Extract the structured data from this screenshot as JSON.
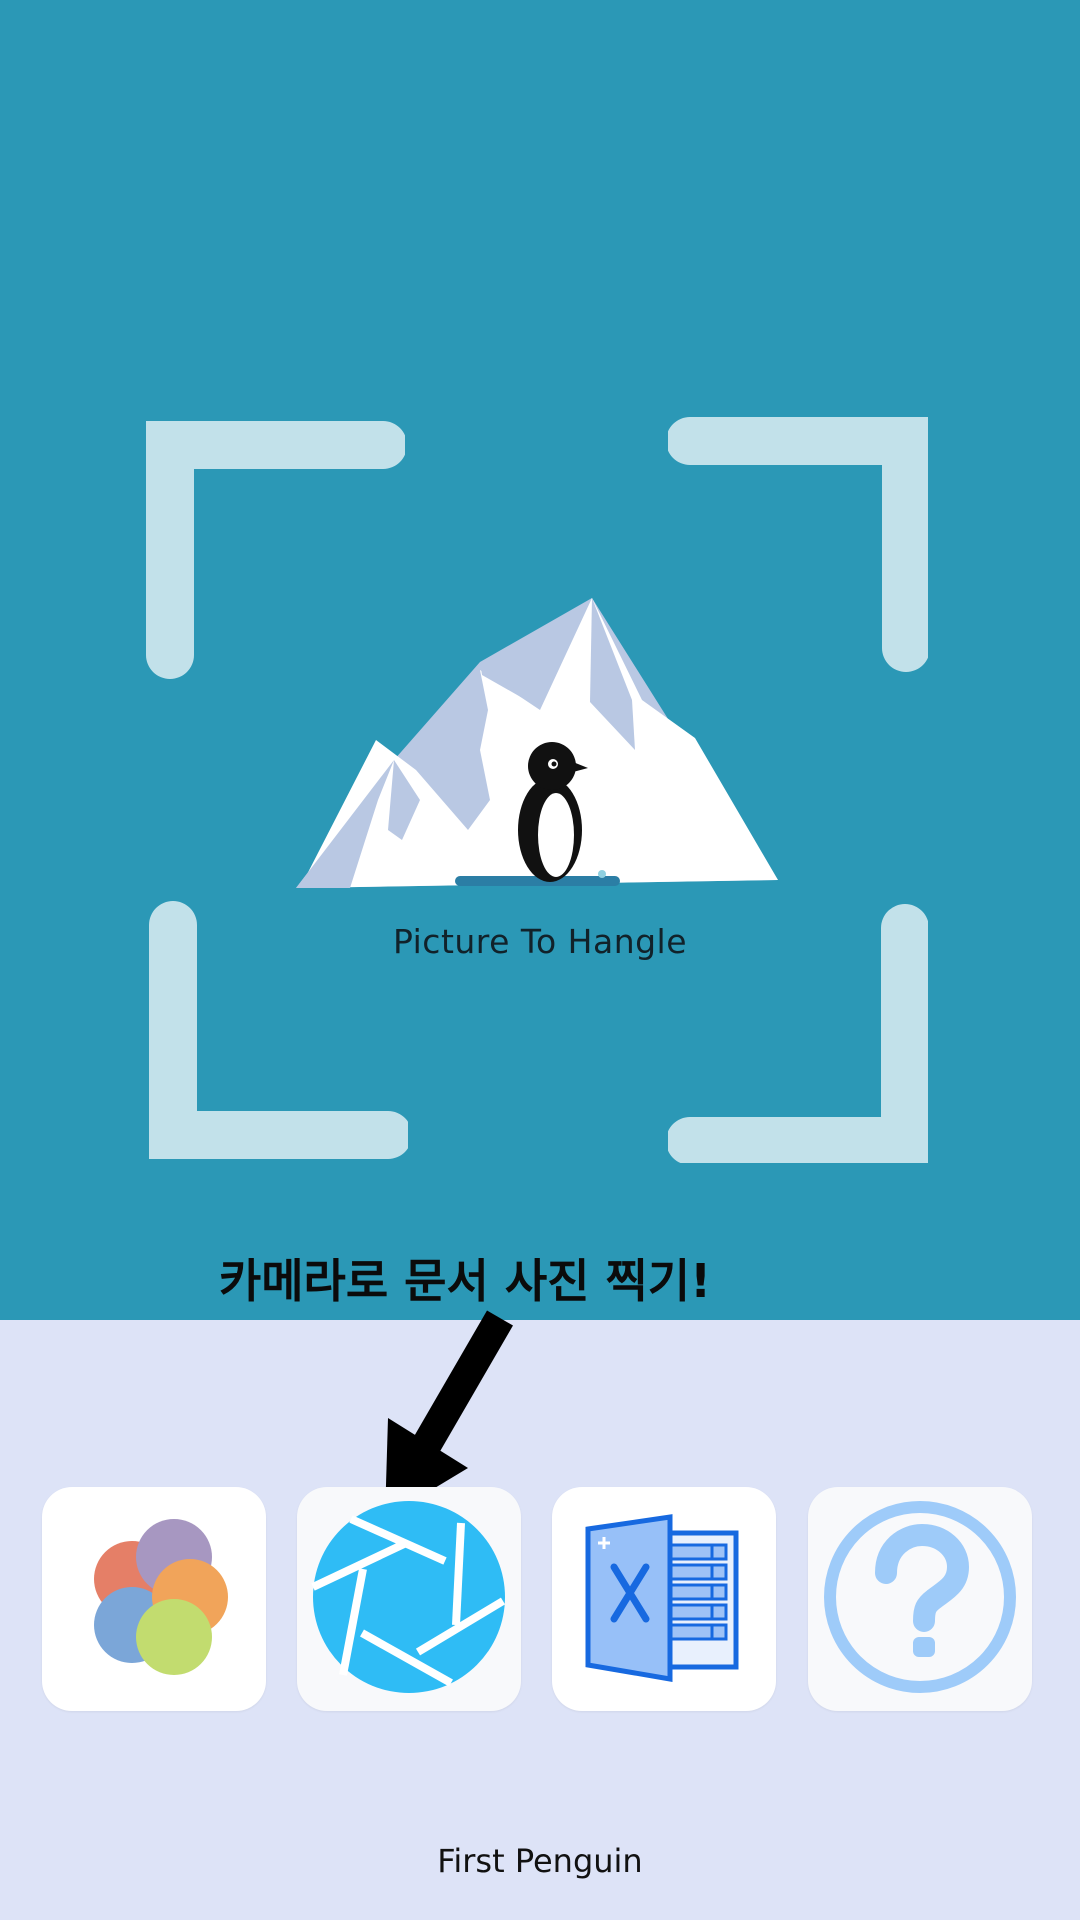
{
  "app": {
    "title": "Picture To Hangle",
    "footer": "First Penguin"
  },
  "hint": {
    "text": "카메라로 문서 사진 찍기!"
  },
  "toolbar": {
    "buttons": [
      {
        "name": "gallery-button",
        "icon": "gallery-icon"
      },
      {
        "name": "camera-button",
        "icon": "camera-shutter-icon"
      },
      {
        "name": "excel-button",
        "icon": "excel-icon"
      },
      {
        "name": "help-button",
        "icon": "help-icon"
      }
    ]
  },
  "colors": {
    "top_background": "#2b98b6",
    "bottom_background": "#dde3f7",
    "frame_corner": "#c2e1ea",
    "camera_icon": "#2fbcf5",
    "help_icon": "#9ecbf9",
    "excel_icon": "#1769e0"
  }
}
